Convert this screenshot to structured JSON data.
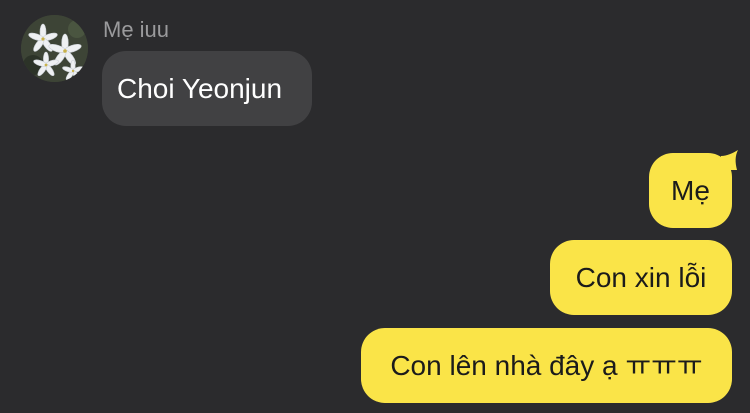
{
  "incoming": {
    "avatar_icon": "white-lily-flowers-icon",
    "sender_name": "Mẹ iuu",
    "message": "Choi Yeonjun"
  },
  "outgoing": {
    "messages": [
      "Mẹ",
      "Con xin lỗi",
      "Con lên nhà đây ạ ㅠㅠㅠ"
    ]
  },
  "colors": {
    "background": "#2b2b2d",
    "incoming_bubble": "#414143",
    "outgoing_bubble": "#fae448",
    "sender_name": "#9a9a9c"
  }
}
